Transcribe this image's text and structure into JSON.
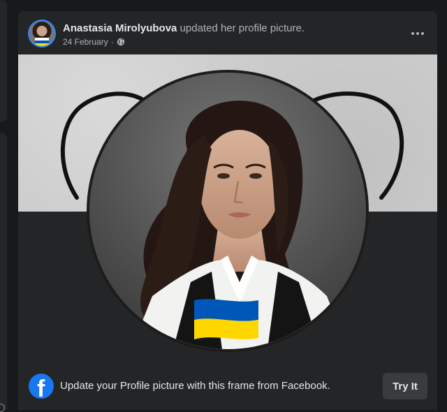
{
  "post": {
    "author": "Anastasia Mirolyubova",
    "action": " updated her profile picture.",
    "date": "24 February",
    "separator": " · ",
    "privacy_icon": "globe-icon",
    "more_icon": "more-horizontal-icon"
  },
  "frame": {
    "flag_colors": {
      "top": "#0057b7",
      "bottom": "#ffd700"
    }
  },
  "footer": {
    "logo_letter": "f",
    "cta_text": "Update your Profile picture with this frame from Facebook.",
    "button_label": "Try It"
  },
  "colors": {
    "background": "#18191a",
    "card": "#242526",
    "text_primary": "#e4e6eb",
    "text_secondary": "#b0b3b8",
    "facebook_blue": "#1877f2",
    "button_bg": "#3a3b3c"
  }
}
